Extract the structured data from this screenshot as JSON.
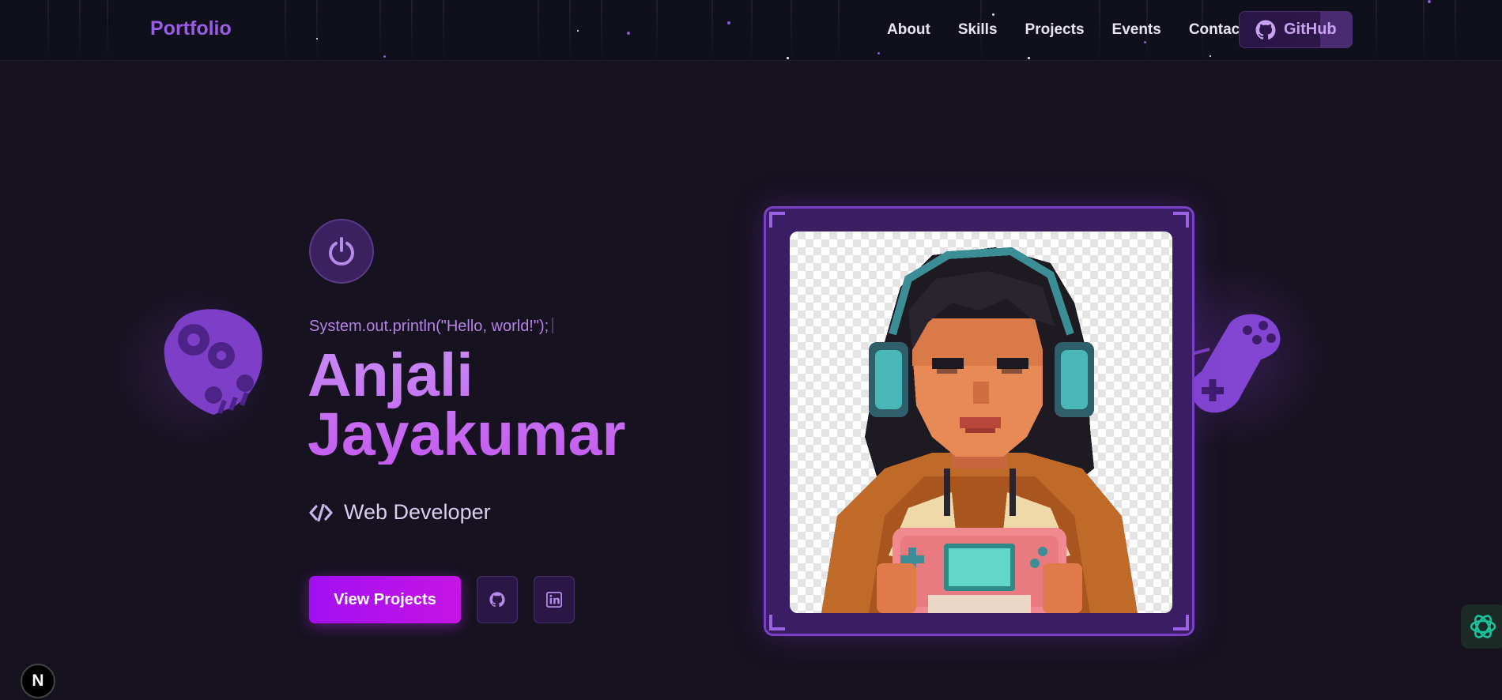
{
  "nav": {
    "brand": "Portfolio",
    "links": [
      "About",
      "Skills",
      "Projects",
      "Events",
      "Contact"
    ],
    "github_label": "GitHub",
    "github_icon": "github-icon"
  },
  "hero": {
    "code_line": "System.out.println(\"Hello, world!\");",
    "name_first": "Anjali",
    "name_last": "Jayakumar",
    "role": "Web Developer",
    "role_icon": "code-icon",
    "power_icon": "power-icon",
    "cta_label": "View Projects",
    "social": [
      {
        "name": "github",
        "icon": "github-icon"
      },
      {
        "name": "linkedin",
        "icon": "linkedin-icon"
      }
    ]
  },
  "portrait": {
    "alt": "Pixel-art portrait wearing headphones holding a game controller",
    "frame_color": "#7a40c8"
  },
  "decorations": {
    "left_icon": "robot-gear-icon",
    "right_icon": "gamepad-icon"
  },
  "badges": {
    "next": "N",
    "ai_icon": "openai-icon"
  },
  "colors": {
    "background": "#16121f",
    "navbar": "#10101c",
    "accent": "#9b5ce6",
    "cta_start": "#a20ff3",
    "cta_end": "#c614e4"
  }
}
